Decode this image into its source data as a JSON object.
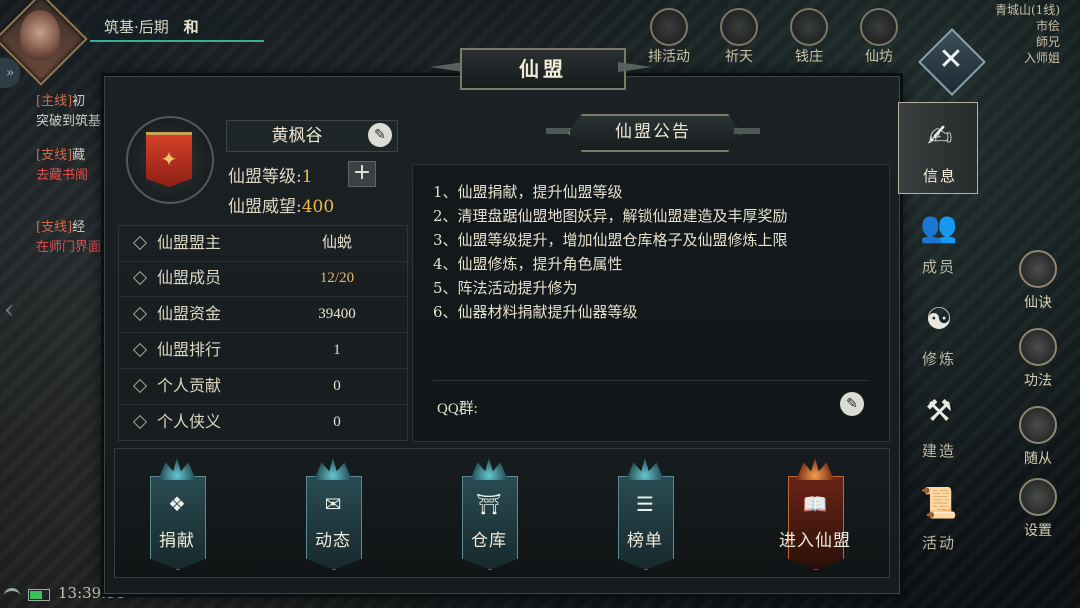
{
  "hud": {
    "realm": "筑基·后期",
    "peace_mode": "和",
    "top_icons": [
      "排活动",
      "祈天",
      "钱庄",
      "仙坊"
    ],
    "minimap": [
      "青城山(1线)",
      "市侩",
      "師兄",
      "入师姐"
    ],
    "chat": [
      {
        "tag": "[主线]",
        "text": "初",
        "sub": "突破到筑基"
      },
      {
        "tag": "[支线]",
        "text": "藏",
        "sub": "去藏书阁"
      },
      {
        "tag": "[支线]",
        "text": "经",
        "sub": "在师门界面"
      }
    ],
    "right_items": [
      "仙诀",
      "功法",
      "随从",
      "设置"
    ],
    "clock": "13:39:51"
  },
  "panel": {
    "title": "仙盟",
    "guild_name": "黄枫谷",
    "level_label": "仙盟等级:",
    "level_value": "1",
    "prestige_label": "仙盟威望:",
    "prestige_value": "400",
    "info_rows": [
      {
        "key": "仙盟盟主",
        "value": "仙蜕"
      },
      {
        "key": "仙盟成员",
        "value": "12/20"
      },
      {
        "key": "仙盟资金",
        "value": "39400"
      },
      {
        "key": "仙盟排行",
        "value": "1"
      },
      {
        "key": "个人贡献",
        "value": "0"
      },
      {
        "key": "个人侠义",
        "value": "0"
      }
    ],
    "announcement_title": "仙盟公告",
    "announcement_lines": [
      "1、仙盟捐献，提升仙盟等级",
      "2、清理盘踞仙盟地图妖异，解锁仙盟建造及丰厚奖励",
      "3、仙盟等级提升，增加仙盟仓库格子及仙盟修炼上限",
      "4、仙盟修炼，提升角色属性",
      "5、阵法活动提升修为",
      "6、仙器材料捐献提升仙器等级"
    ],
    "qq_label": "QQ群:",
    "bottom_buttons": [
      "捐献",
      "动态",
      "仓库",
      "榜单",
      "进入仙盟"
    ],
    "tabs": [
      "信息",
      "成员",
      "修炼",
      "建造",
      "活动"
    ]
  },
  "colors": {
    "accent_gold": "#f0b94a",
    "teal": "#3fae8e",
    "primary_red": "#d3412a"
  }
}
